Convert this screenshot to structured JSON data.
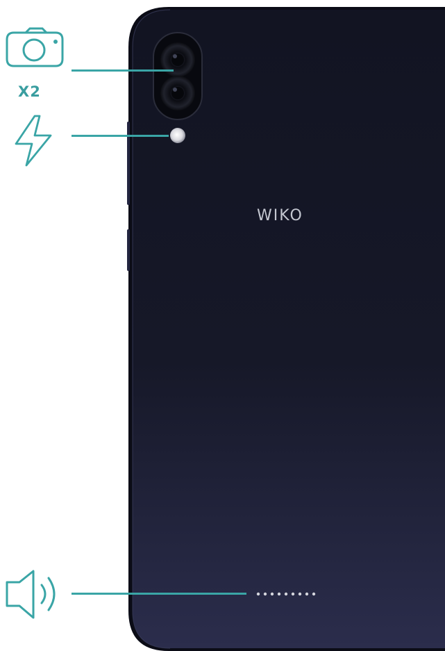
{
  "brand": {
    "name": "WIKO"
  },
  "callouts": {
    "camera": {
      "icon": "camera-icon",
      "multiplier": "X2"
    },
    "flash": {
      "icon": "flash-icon"
    },
    "speaker": {
      "icon": "speaker-icon"
    }
  },
  "colors": {
    "accent": "#3aa5a6",
    "phone_body": "#141627",
    "phone_body_bottom": "#2a2c4a",
    "brand_text": "#c4c7d1"
  }
}
